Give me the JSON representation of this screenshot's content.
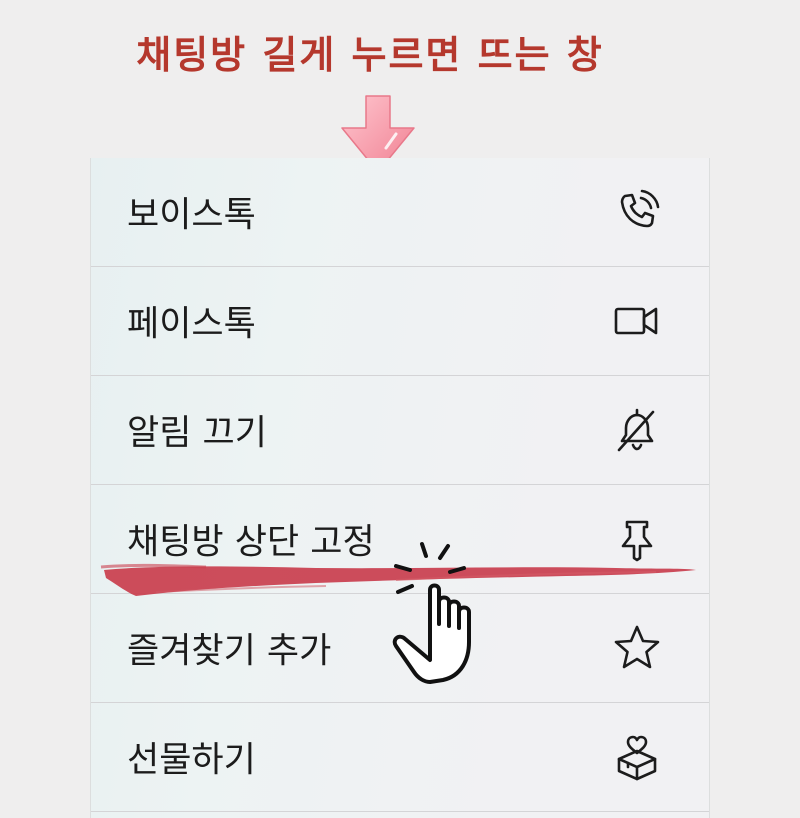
{
  "caption": "채팅방 길게 누르면 뜨는 창",
  "menu": {
    "items": [
      {
        "label": "보이스톡",
        "icon": "phone-icon"
      },
      {
        "label": "페이스톡",
        "icon": "video-camera-icon"
      },
      {
        "label": "알림 끄기",
        "icon": "bell-off-icon"
      },
      {
        "label": "채팅방 상단 고정",
        "icon": "pin-icon"
      },
      {
        "label": "즐겨찾기 추가",
        "icon": "star-icon"
      },
      {
        "label": "선물하기",
        "icon": "gift-box-icon"
      }
    ]
  },
  "colors": {
    "caption": "#b5382d",
    "arrow": "#f58a9a",
    "highlight": "#c9404f",
    "background": "#efeeee"
  }
}
